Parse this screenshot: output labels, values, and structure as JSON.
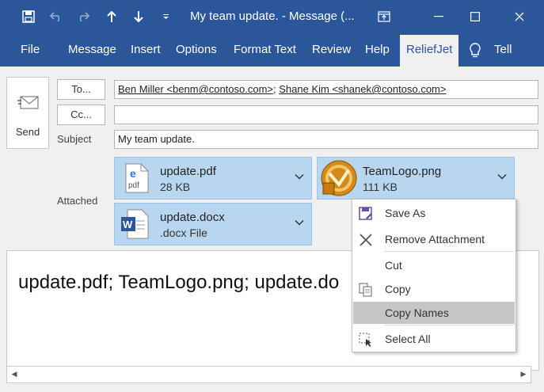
{
  "window": {
    "title": "My team update.  -  Message (..."
  },
  "ribbon": {
    "tabs": [
      "File",
      "Message",
      "Insert",
      "Options",
      "Format Text",
      "Review",
      "Help",
      "ReliefJet",
      "Tell"
    ],
    "active": "ReliefJet"
  },
  "form": {
    "send_label": "Send",
    "to_label": "To...",
    "cc_label": "Cc...",
    "subject_label": "Subject",
    "attached_label": "Attached",
    "recipients": [
      "Ben Miller <benm@contoso.com>",
      "Shane Kim <shanek@contoso.com>"
    ],
    "recipient_separator": ";",
    "cc_value": "",
    "subject_value": "My team update."
  },
  "attachments": [
    {
      "name": "update.pdf",
      "size": "28 KB",
      "icon": "pdf-file-icon"
    },
    {
      "name": "TeamLogo.png",
      "size": "111 KB",
      "icon": "image-file-icon"
    },
    {
      "name": "update.docx",
      "size": ".docx File",
      "icon": "word-file-icon"
    }
  ],
  "body": {
    "text": "update.pdf; TeamLogo.png; update.do"
  },
  "context_menu": {
    "items": [
      "Save As",
      "Remove Attachment",
      "Cut",
      "Copy",
      "Copy Names",
      "Select All"
    ],
    "highlighted": "Copy Names"
  },
  "colors": {
    "accent": "#2b579a",
    "attachment_bg": "#b8d6f0",
    "menu_highlight": "#c6c6c6"
  }
}
